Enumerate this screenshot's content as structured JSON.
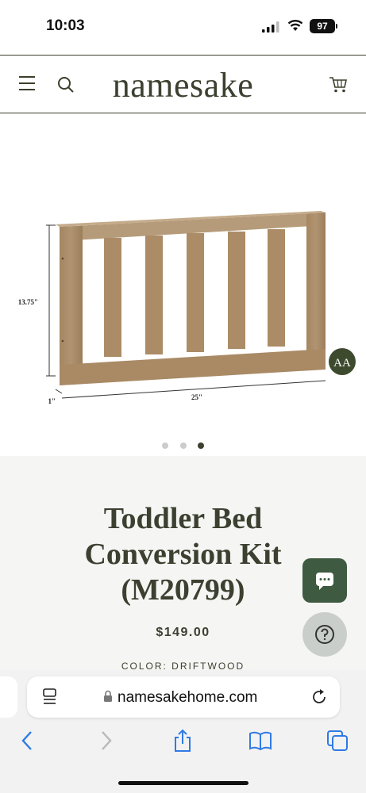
{
  "status_bar": {
    "time": "10:03",
    "battery": "97"
  },
  "header": {
    "logo": "namesake"
  },
  "product_image": {
    "dimensions": {
      "height": "13.75\"",
      "depth": "1\"",
      "width": "25\""
    },
    "badge": "AA",
    "slides_total": 3,
    "slide_active": 3
  },
  "product": {
    "title_lines": [
      "Toddler Bed",
      "Conversion Kit",
      "(M20799)"
    ],
    "price": "$149.00",
    "color_label": "COLOR: DRIFTWOOD"
  },
  "browser": {
    "url": "namesakehome.com"
  },
  "colors": {
    "brand": "#3c4030",
    "wood": "#a98a62",
    "chat": "#3e5a40"
  }
}
